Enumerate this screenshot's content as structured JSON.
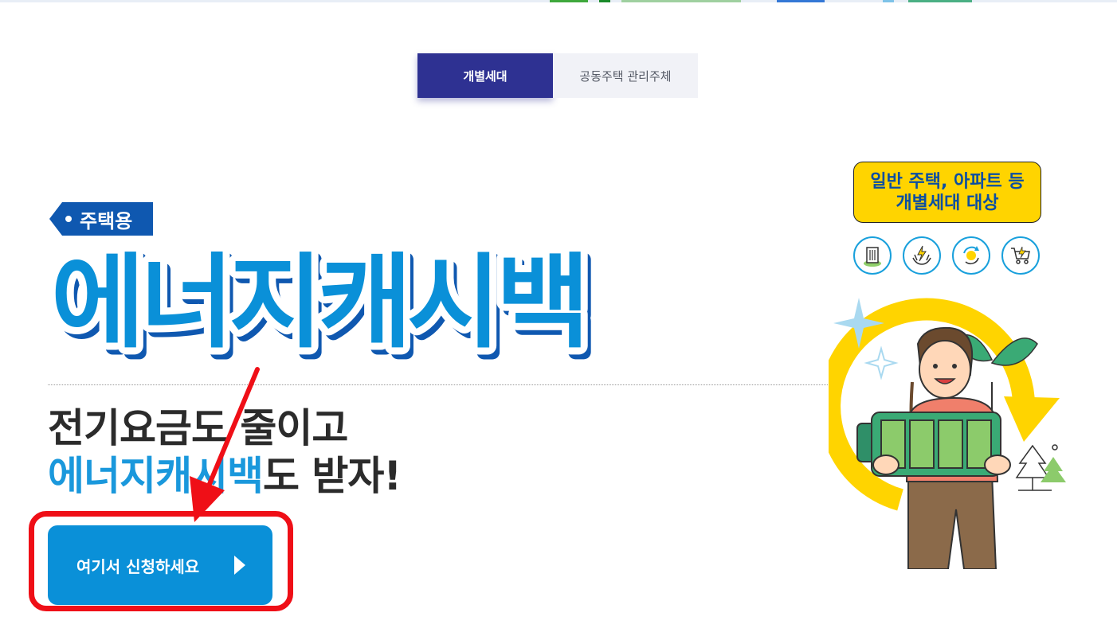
{
  "tabs": [
    {
      "label": "개별세대",
      "active": true
    },
    {
      "label": "공동주택 관리주체",
      "active": false
    }
  ],
  "badge": {
    "label": "주택용"
  },
  "title": {
    "text": "에너지캐시백"
  },
  "headline": {
    "line1": "전기요금도 줄이고",
    "line2_accent": "에너지캐시백",
    "line2_rest": "도 받자!"
  },
  "cta": {
    "label": "여기서 신청하세요"
  },
  "target": {
    "line1": "일반 주택, 아파트 등",
    "line2": "개별세대 대상"
  },
  "icons": [
    "building-icon",
    "hands-energy-icon",
    "recycle-icon",
    "cart-icon"
  ],
  "colors": {
    "tab_active": "#2e3192",
    "accent_blue": "#1a98dc",
    "button_blue": "#0a90d8",
    "highlight_red": "#ef0f17",
    "target_yellow": "#ffd400"
  }
}
